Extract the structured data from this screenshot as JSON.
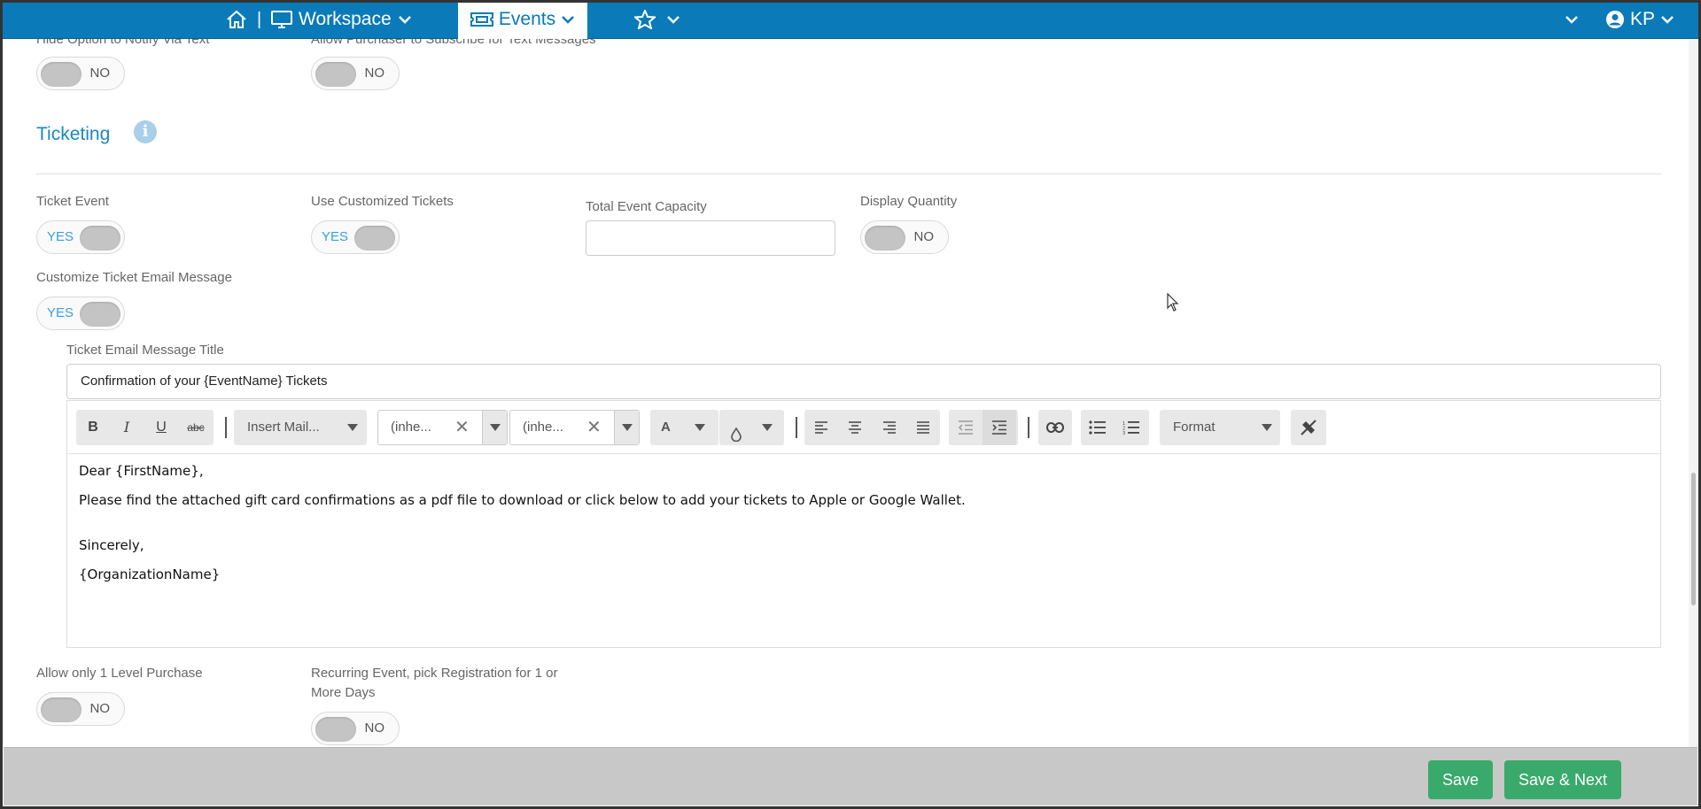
{
  "nav": {
    "separator": "|",
    "workspace": "Workspace",
    "events": "Events",
    "user_initials": "KP",
    "icons": [
      "home-icon",
      "monitor-icon",
      "ticket-icon",
      "star-icon",
      "chevron-down-icon",
      "user-circle-icon"
    ]
  },
  "top_row": {
    "hide_notify_label": "Hide Option to Notify Via Text",
    "hide_notify_value": "NO",
    "subscribe_label": "Allow Purchaser to Subscribe for Text Messages",
    "subscribe_value": "NO"
  },
  "ticketing": {
    "title": "Ticketing",
    "info_glyph": "i",
    "ticket_event_label": "Ticket Event",
    "ticket_event_value": "YES",
    "custom_tickets_label": "Use Customized Tickets",
    "custom_tickets_value": "YES",
    "capacity_label": "Total Event Capacity",
    "capacity_value": "",
    "display_qty_label": "Display Quantity",
    "display_qty_value": "NO",
    "customize_email_label": "Customize Ticket Email Message",
    "customize_email_value": "YES",
    "email_title_label": "Ticket Email Message Title",
    "email_title_value": "Confirmation of your {EventName} Tickets"
  },
  "toolbar": {
    "bold": "B",
    "italic": "I",
    "underline": "U",
    "strike": "abc",
    "insert_mail": "Insert Mail...",
    "font_family": "(inhe...",
    "font_size": "(inhe...",
    "clear_glyph": "✕",
    "font_color": "A",
    "format": "Format"
  },
  "editor": {
    "line1": "Dear {FirstName},",
    "line2": "Please find the attached gift card confirmations as a pdf file to download or click below to add your tickets to Apple or Google Wallet.",
    "line3": "Sincerely,",
    "line4": "{OrganizationName}"
  },
  "bottom_row": {
    "one_level_label": "Allow only 1 Level Purchase",
    "one_level_value": "NO",
    "recurring_label_1": "Recurring Event, pick Registration for 1 or",
    "recurring_label_2": "More Days",
    "recurring_value": "NO"
  },
  "footer": {
    "save": "Save",
    "save_next": "Save & Next"
  },
  "colors": {
    "nav_bg": "#0a7ab8",
    "accent_blue": "#1a87c4",
    "button_green": "#3aaa6c",
    "footer_bg": "#c8c8c8"
  }
}
